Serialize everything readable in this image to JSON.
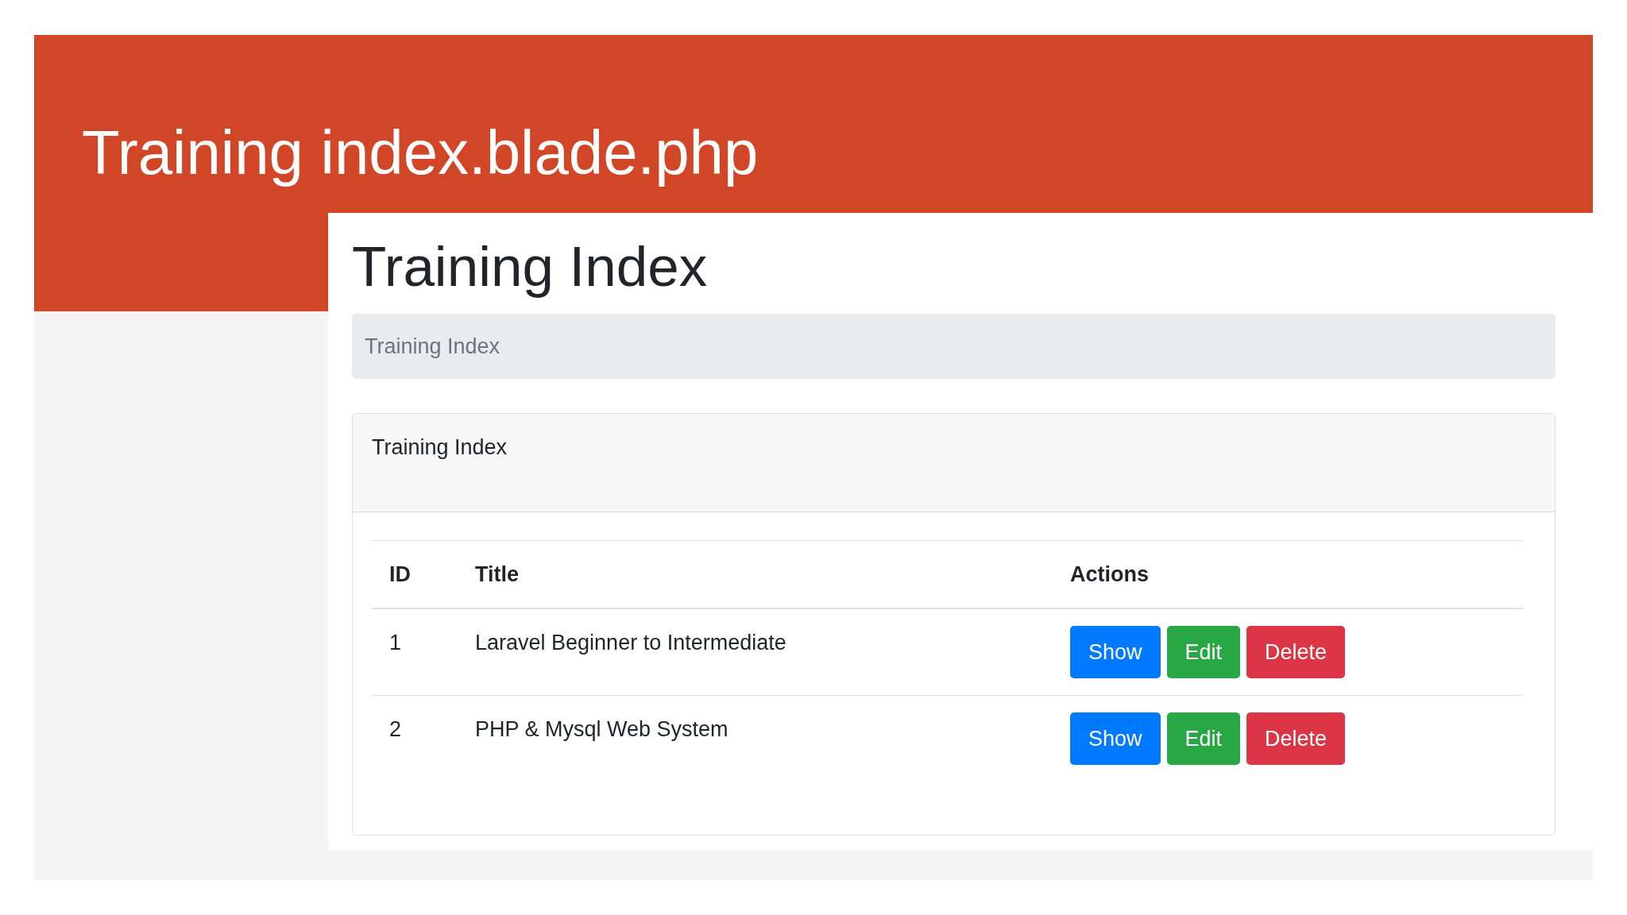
{
  "slide": {
    "title": "Training index.blade.php"
  },
  "page": {
    "heading": "Training Index",
    "breadcrumb": [
      {
        "label": "Training Index"
      }
    ],
    "card": {
      "header": "Training Index",
      "table": {
        "columns": [
          "ID",
          "Title",
          "Actions"
        ],
        "rows": [
          {
            "id": "1",
            "title": "Laravel Beginner to Intermediate",
            "actions": [
              {
                "label": "Show",
                "color": "#007bff"
              },
              {
                "label": "Edit",
                "color": "#28a745"
              },
              {
                "label": "Delete",
                "color": "#dc3545"
              }
            ]
          },
          {
            "id": "2",
            "title": "PHP & Mysql Web System",
            "actions": [
              {
                "label": "Show",
                "color": "#007bff"
              },
              {
                "label": "Edit",
                "color": "#28a745"
              },
              {
                "label": "Delete",
                "color": "#dc3545"
              }
            ]
          }
        ]
      }
    }
  }
}
